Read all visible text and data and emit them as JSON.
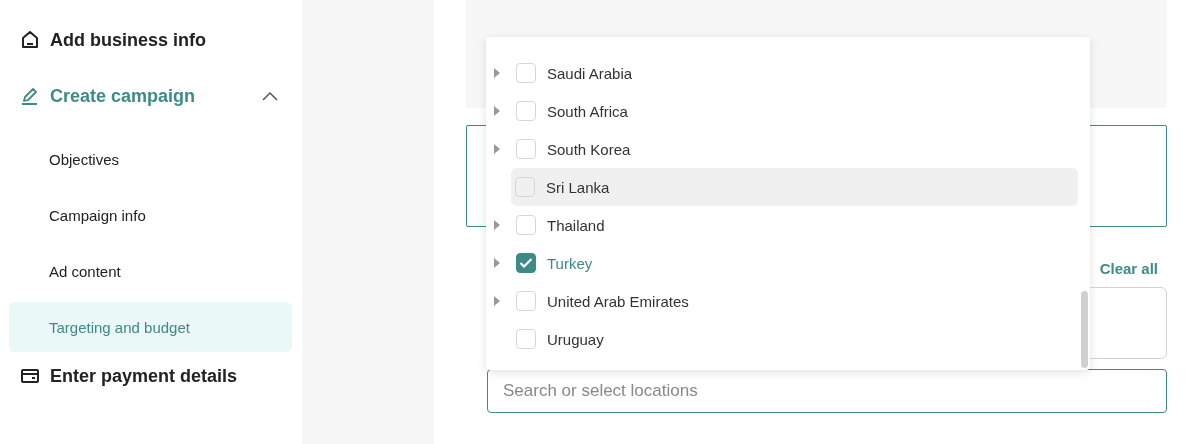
{
  "sidebar": {
    "items": [
      {
        "label": "Add business info",
        "kind": "section",
        "selected": false,
        "expanded": false
      },
      {
        "label": "Create campaign",
        "kind": "section",
        "selected": true,
        "expanded": true
      },
      {
        "label": "Objectives",
        "kind": "sub",
        "selected": false
      },
      {
        "label": "Campaign info",
        "kind": "sub",
        "selected": false
      },
      {
        "label": "Ad content",
        "kind": "sub",
        "selected": false
      },
      {
        "label": "Targeting and budget",
        "kind": "sub",
        "selected": true
      },
      {
        "label": "Enter payment details",
        "kind": "section",
        "selected": false,
        "expanded": false
      }
    ]
  },
  "clear_all": "Clear all",
  "search": {
    "placeholder": "Search or select locations"
  },
  "dropdown": {
    "options": [
      {
        "label": "Saudi Arabia",
        "has_children": true,
        "checked": false,
        "hovered": false
      },
      {
        "label": "South Africa",
        "has_children": true,
        "checked": false,
        "hovered": false
      },
      {
        "label": "South Korea",
        "has_children": true,
        "checked": false,
        "hovered": false
      },
      {
        "label": "Sri Lanka",
        "has_children": false,
        "checked": false,
        "hovered": true
      },
      {
        "label": "Thailand",
        "has_children": true,
        "checked": false,
        "hovered": false
      },
      {
        "label": "Turkey",
        "has_children": true,
        "checked": true,
        "hovered": false
      },
      {
        "label": "United Arab Emirates",
        "has_children": true,
        "checked": false,
        "hovered": false
      },
      {
        "label": "Uruguay",
        "has_children": false,
        "checked": false,
        "hovered": false
      }
    ]
  }
}
